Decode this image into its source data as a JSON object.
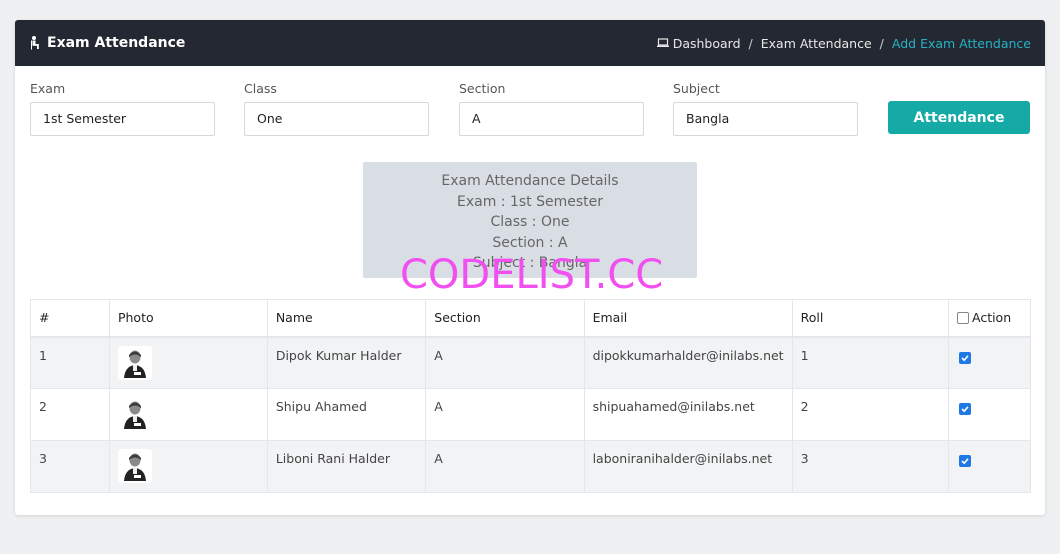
{
  "header": {
    "title": "Exam Attendance",
    "breadcrumbs": [
      "Dashboard",
      "Exam Attendance",
      "Add Exam Attendance"
    ],
    "breadcrumb_sep": "/"
  },
  "filters": {
    "exam": {
      "label": "Exam",
      "value": "1st Semester"
    },
    "class": {
      "label": "Class",
      "value": "One"
    },
    "section": {
      "label": "Section",
      "value": "A"
    },
    "subject": {
      "label": "Subject",
      "value": "Bangla"
    },
    "button": "Attendance"
  },
  "details": {
    "heading": "Exam Attendance Details",
    "exam": "Exam : 1st Semester",
    "class": "Class : One",
    "section": "Section : A",
    "subject": "Subject : Bangla"
  },
  "watermark": "CODELIST.CC",
  "table": {
    "columns": [
      "#",
      "Photo",
      "Name",
      "Section",
      "Email",
      "Roll",
      "Action"
    ],
    "rows": [
      {
        "num": "1",
        "name": "Dipok Kumar Halder",
        "section": "A",
        "email": "dipokkumarhalder@inilabs.net",
        "roll": "1",
        "checked": true
      },
      {
        "num": "2",
        "name": "Shipu Ahamed",
        "section": "A",
        "email": "shipuahamed@inilabs.net",
        "roll": "2",
        "checked": true
      },
      {
        "num": "3",
        "name": "Liboni Rani Halder",
        "section": "A",
        "email": "laboniranihalder@inilabs.net",
        "roll": "3",
        "checked": true
      }
    ]
  },
  "colors": {
    "topbar": "#232832",
    "accent": "#15aaa5",
    "breadcrumb_active": "#26b2c4",
    "checkbox": "#1e78e6"
  }
}
